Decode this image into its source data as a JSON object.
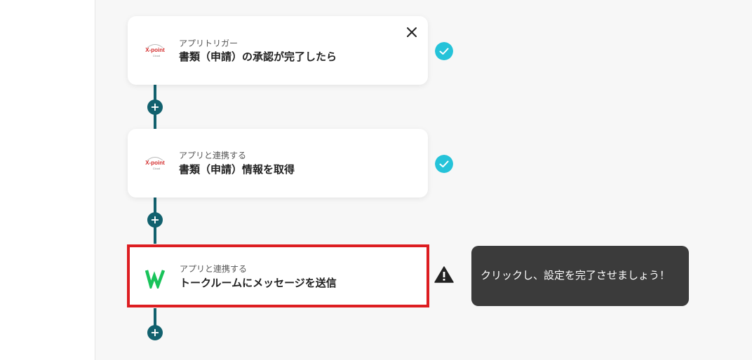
{
  "flow": {
    "steps": [
      {
        "subtitle": "アプリトリガー",
        "title": "書類（申請）の承認が完了したら",
        "app_logo": "xpoint-cloud-logo",
        "status": "complete"
      },
      {
        "subtitle": "アプリと連携する",
        "title": "書類（申請）情報を取得",
        "app_logo": "xpoint-cloud-logo",
        "status": "complete"
      },
      {
        "subtitle": "アプリと連携する",
        "title": "トークルームにメッセージを送信",
        "app_logo": "lineworks-logo",
        "status": "warning"
      }
    ],
    "add_label": "+",
    "tooltip": "クリックし、設定を完了させましょう！",
    "logo_text": {
      "brand": "X-point",
      "sub": "Cloud"
    }
  },
  "colors": {
    "accent": "#12616e",
    "check": "#25c3d9",
    "highlight": "#dd1d21",
    "tooltip_bg": "#3b3b3b"
  }
}
